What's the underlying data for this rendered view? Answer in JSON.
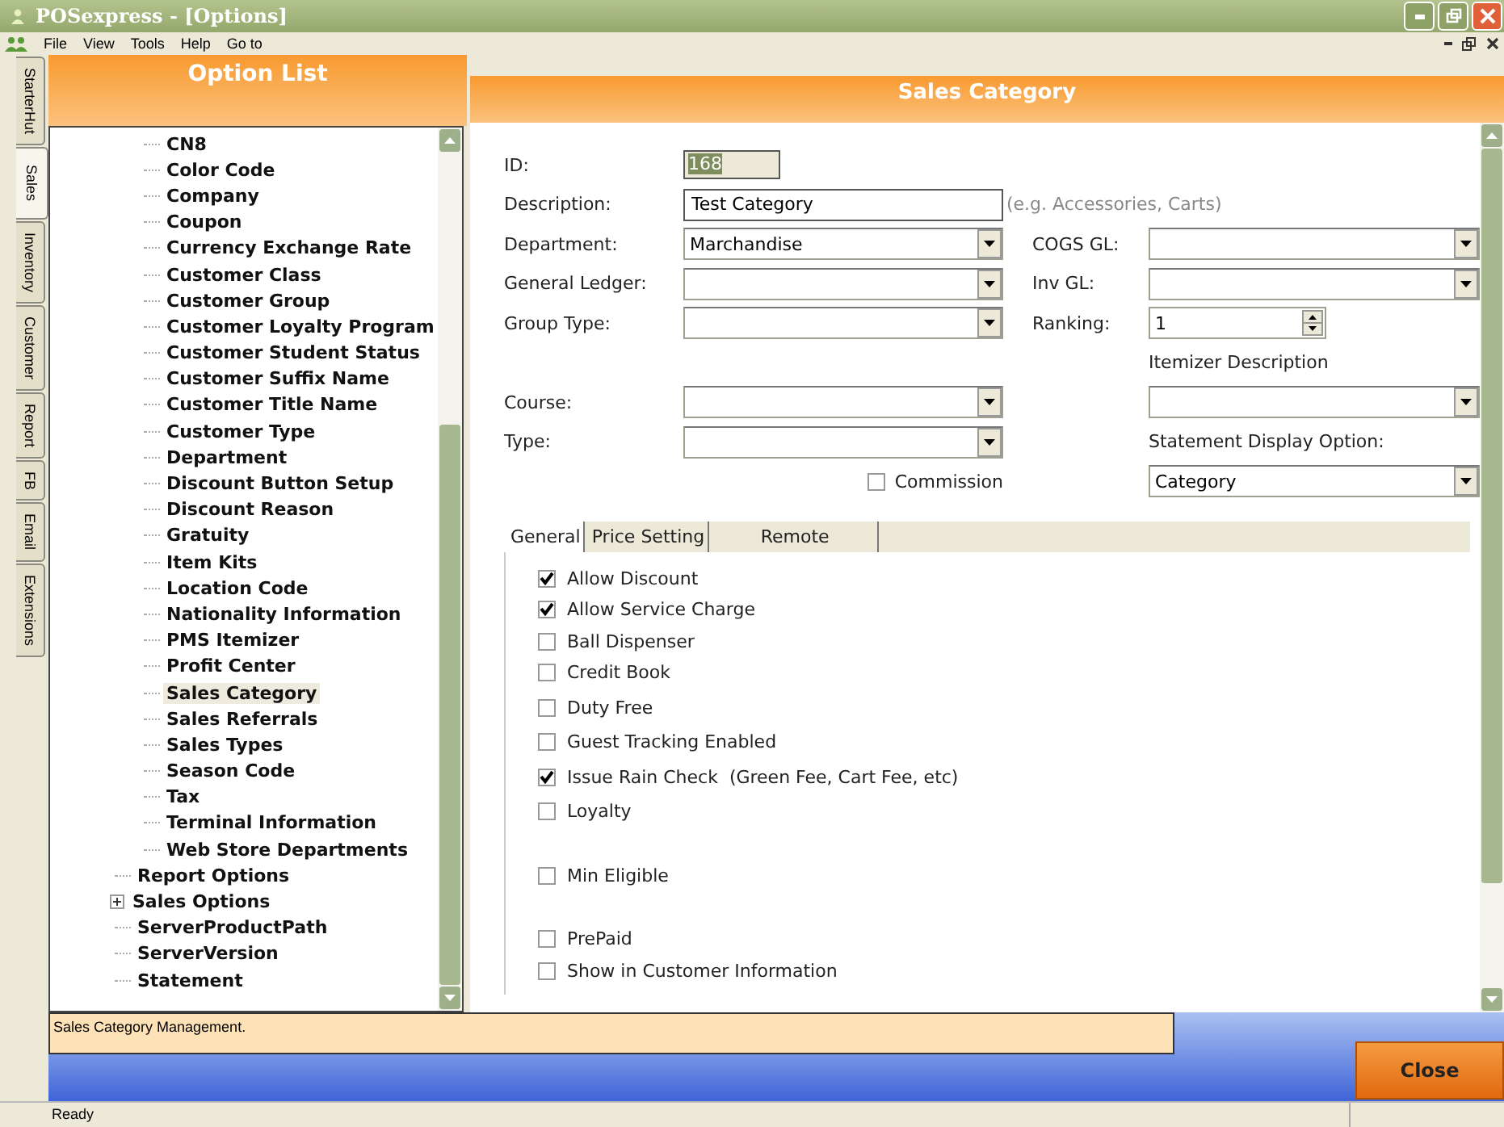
{
  "window": {
    "title": "POSexpress - [Options]"
  },
  "menu": [
    "File",
    "View",
    "Tools",
    "Help",
    "Go to"
  ],
  "side_tabs": [
    {
      "label": "StarterHut",
      "selected": false
    },
    {
      "label": "Sales",
      "selected": true
    },
    {
      "label": "Inventory",
      "selected": false
    },
    {
      "label": "Customer",
      "selected": false
    },
    {
      "label": "Report",
      "selected": false
    },
    {
      "label": "FB",
      "selected": false
    },
    {
      "label": "Email",
      "selected": false
    },
    {
      "label": "Extensions",
      "selected": false
    }
  ],
  "option_list": {
    "title": "Option List",
    "items": [
      {
        "kind": "group",
        "children": [
          {
            "label": "CN8",
            "selected": false
          },
          {
            "label": "Color Code",
            "selected": false
          },
          {
            "label": "Company",
            "selected": false
          },
          {
            "label": "Coupon",
            "selected": false
          },
          {
            "label": "Currency Exchange Rate",
            "selected": false
          },
          {
            "label": "Customer Class",
            "selected": false
          },
          {
            "label": "Customer Group",
            "selected": false
          },
          {
            "label": "Customer Loyalty Program",
            "selected": false
          },
          {
            "label": "Customer Student Status",
            "selected": false
          },
          {
            "label": "Customer Suffix Name",
            "selected": false
          },
          {
            "label": "Customer Title Name",
            "selected": false
          },
          {
            "label": "Customer Type",
            "selected": false
          },
          {
            "label": "Department",
            "selected": false
          },
          {
            "label": "Discount Button Setup",
            "selected": false
          },
          {
            "label": "Discount Reason",
            "selected": false
          },
          {
            "label": "Gratuity",
            "selected": false
          },
          {
            "label": "Item Kits",
            "selected": false
          },
          {
            "label": "Location Code",
            "selected": false
          },
          {
            "label": "Nationality Information",
            "selected": false
          },
          {
            "label": "PMS Itemizer",
            "selected": false
          },
          {
            "label": "Profit Center",
            "selected": false
          },
          {
            "label": "Sales Category",
            "selected": true
          },
          {
            "label": "Sales Referrals",
            "selected": false
          },
          {
            "label": "Sales Types",
            "selected": false
          },
          {
            "label": "Season Code",
            "selected": false
          },
          {
            "label": "Tax",
            "selected": false
          },
          {
            "label": "Terminal Information",
            "selected": false
          },
          {
            "label": "Web Store Departments",
            "selected": false
          }
        ]
      },
      {
        "kind": "leaf",
        "label": "Report Options",
        "selected": false
      },
      {
        "kind": "folder",
        "label": "Sales Options",
        "selected": false,
        "expanded": false
      },
      {
        "kind": "leaf",
        "label": "ServerProductPath",
        "selected": false
      },
      {
        "kind": "leaf",
        "label": "ServerVersion",
        "selected": false
      },
      {
        "kind": "leaf",
        "label": "Statement",
        "selected": false
      }
    ]
  },
  "panel": {
    "title": "Sales Category"
  },
  "form": {
    "id": {
      "label": "ID:",
      "value": "168"
    },
    "description": {
      "label": "Description:",
      "value": "Test Category",
      "note": "(e.g. Accessories, Carts)"
    },
    "department": {
      "label": "Department:",
      "value": "Marchandise"
    },
    "general_ledger": {
      "label": "General Ledger:"
    },
    "group_type": {
      "label": "Group Type:"
    },
    "course": {
      "label": "Course:"
    },
    "type": {
      "label": "Type:"
    },
    "commission": {
      "label": "Commission",
      "checked": false
    },
    "cogs_gl": {
      "label": "COGS GL:"
    },
    "inv_gl": {
      "label": "Inv GL:"
    },
    "ranking": {
      "label": "Ranking:",
      "value": "1"
    },
    "itemizer_description": {
      "label": "Itemizer Description"
    },
    "statement_display_option": {
      "label": "Statement Display Option:",
      "value": "Category"
    }
  },
  "tabs": [
    {
      "label": "General",
      "selected": true
    },
    {
      "label": "Price Setting",
      "selected": false
    },
    {
      "label": "Remote",
      "selected": false
    }
  ],
  "options": [
    {
      "label": "Allow Discount",
      "checked": true
    },
    {
      "label": "Allow Service Charge",
      "checked": true
    },
    {
      "label": "Ball Dispenser",
      "checked": false
    },
    {
      "label": "Credit Book",
      "checked": false
    },
    {
      "label": "Duty Free",
      "checked": false
    },
    {
      "label": "Guest Tracking Enabled",
      "checked": false
    },
    {
      "label": "Issue Rain Check  (Green Fee, Cart Fee, etc)",
      "checked": true
    },
    {
      "label": "Loyalty",
      "checked": false
    },
    {
      "label": "Min Eligible",
      "checked": false
    },
    {
      "label": "PrePaid",
      "checked": false
    },
    {
      "label": "Show in Customer Information",
      "checked": false
    }
  ],
  "description_bar": "Sales Category Management.",
  "close_button": "Close",
  "status_bar": "Ready"
}
